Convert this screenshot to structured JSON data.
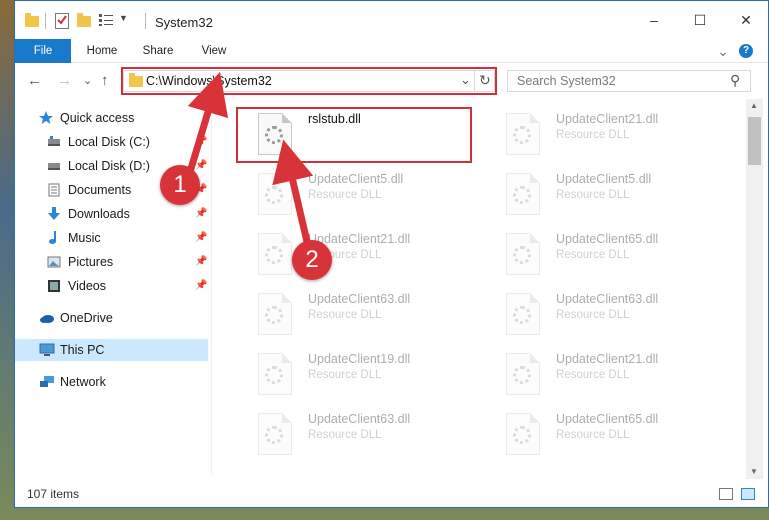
{
  "window": {
    "title": "System32"
  },
  "controls": {
    "minimize": "–",
    "maximize": "☐",
    "close": "✕"
  },
  "ribbon": {
    "file": "File",
    "home": "Home",
    "share": "Share",
    "view": "View",
    "collapse": "⌄",
    "help": "?"
  },
  "address": {
    "path": "C:\\Windows\\System32",
    "refresh": "↻",
    "dropdown": "⌄"
  },
  "search": {
    "placeholder": "Search System32",
    "icon": "⚲"
  },
  "nav": {
    "back": "←",
    "forward": "→",
    "recent": "⌄",
    "up": "↑",
    "items": [
      {
        "label": "Quick access",
        "icon": "star-icon"
      },
      {
        "label": "Local Disk (C:)",
        "icon": "drive-icon",
        "pinned": true
      },
      {
        "label": "Local Disk (D:)",
        "icon": "drive-icon",
        "pinned": true
      },
      {
        "label": "Documents",
        "icon": "documents-icon",
        "pinned": true
      },
      {
        "label": "Downloads",
        "icon": "download-icon",
        "pinned": true
      },
      {
        "label": "Music",
        "icon": "music-icon",
        "pinned": true
      },
      {
        "label": "Pictures",
        "icon": "pictures-icon",
        "pinned": true
      },
      {
        "label": "Videos",
        "icon": "videos-icon",
        "pinned": true
      },
      {
        "label": "OneDrive",
        "icon": "cloud-icon"
      },
      {
        "label": "This PC",
        "icon": "pc-icon",
        "selected": true
      },
      {
        "label": "Network",
        "icon": "network-icon"
      }
    ]
  },
  "files": [
    {
      "name": "rslstub.dll",
      "type": ""
    },
    {
      "name": "UpdateClient21.dll",
      "type": "Resource DLL"
    },
    {
      "name": "UpdateClient5.dll",
      "type": "Resource DLL"
    },
    {
      "name": "UpdateClient5.dll",
      "type": "Resource DLL"
    },
    {
      "name": "UpdateClient21.dll",
      "type": "Resource DLL"
    },
    {
      "name": "UpdateClient65.dll",
      "type": "Resource DLL"
    },
    {
      "name": "UpdateClient63.dll",
      "type": "Resource DLL"
    },
    {
      "name": "UpdateClient63.dll",
      "type": "Resource DLL"
    },
    {
      "name": "UpdateClient19.dll",
      "type": "Resource DLL"
    },
    {
      "name": "UpdateClient21.dll",
      "type": "Resource DLL"
    },
    {
      "name": "UpdateClient63.dll",
      "type": "Resource DLL"
    },
    {
      "name": "UpdateClient65.dll",
      "type": "Resource DLL"
    }
  ],
  "status": {
    "count": "107 items"
  },
  "callouts": {
    "one": "1",
    "two": "2"
  },
  "colors": {
    "accent": "#1979ca",
    "highlight": "#d0303a",
    "selection": "#cce8ff"
  }
}
